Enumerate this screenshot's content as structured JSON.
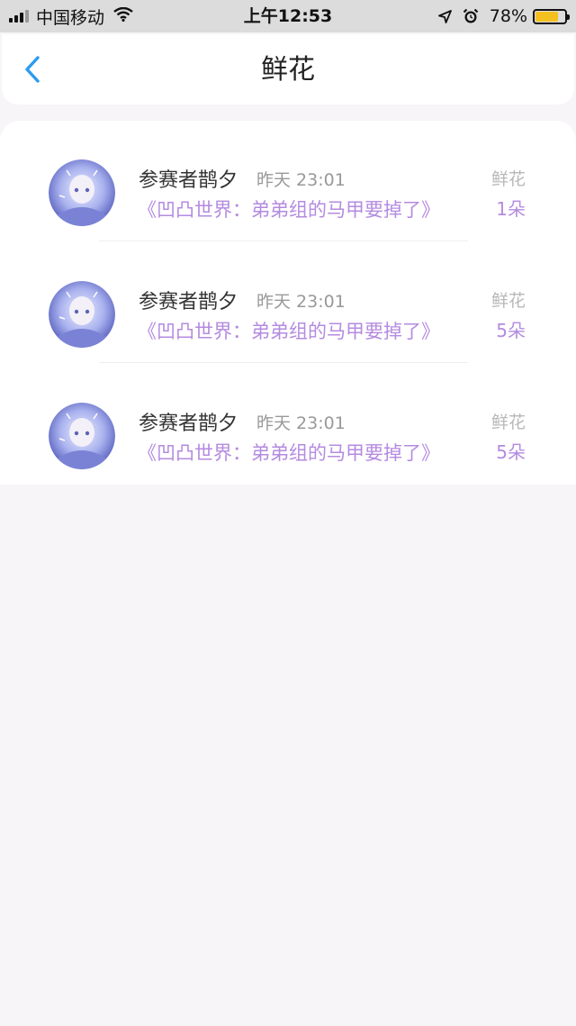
{
  "status_bar": {
    "carrier": "中国移动",
    "time": "上午12:53",
    "battery_percent": "78%",
    "battery_level": 0.78,
    "battery_color": "#f4c020",
    "icons": [
      "signal-icon",
      "wifi-icon",
      "location-arrow-icon",
      "alarm-clock-icon",
      "battery-icon"
    ]
  },
  "nav": {
    "title": "鲜花",
    "back_icon": "chevron-left-icon",
    "accent_color": "#2d9bf0"
  },
  "records": [
    {
      "user": "参赛者鹊夕",
      "time": "昨天 23:01",
      "work": "《凹凸世界：弟弟组的马甲要掉了》",
      "gift_label": "鲜花",
      "count": "1朵"
    },
    {
      "user": "参赛者鹊夕",
      "time": "昨天 23:01",
      "work": "《凹凸世界：弟弟组的马甲要掉了》",
      "gift_label": "鲜花",
      "count": "5朵"
    },
    {
      "user": "参赛者鹊夕",
      "time": "昨天 23:01",
      "work": "《凹凸世界：弟弟组的马甲要掉了》",
      "gift_label": "鲜花",
      "count": "5朵"
    }
  ],
  "colors": {
    "purple_text": "#b48be0",
    "page_background": "#f7f5f7"
  }
}
